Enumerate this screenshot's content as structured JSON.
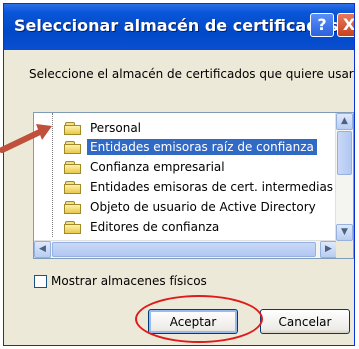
{
  "window": {
    "title": "Seleccionar almacén de certificados",
    "help_label": "?",
    "close_label": "X"
  },
  "prompt": "Seleccione el almacén de certificados que quiere usar.",
  "store_list": {
    "items": [
      {
        "label": "Personal",
        "selected": false
      },
      {
        "label": "Entidades emisoras raíz de confianza",
        "selected": true
      },
      {
        "label": "Confianza empresarial",
        "selected": false
      },
      {
        "label": "Entidades emisoras de cert. intermedias",
        "selected": false
      },
      {
        "label": "Objeto de usuario de Active Directory",
        "selected": false
      },
      {
        "label": "Editores de confianza",
        "selected": false
      }
    ]
  },
  "show_physical": {
    "label": "Mostrar almacenes físicos",
    "checked": false
  },
  "buttons": {
    "accept": "Aceptar",
    "cancel": "Cancelar"
  },
  "annotations": {
    "highlight_color": "#e01a1a",
    "arrow_color": "#c0503c"
  },
  "colors": {
    "titlebar": "#0a56d8",
    "selection": "#316ac5"
  }
}
